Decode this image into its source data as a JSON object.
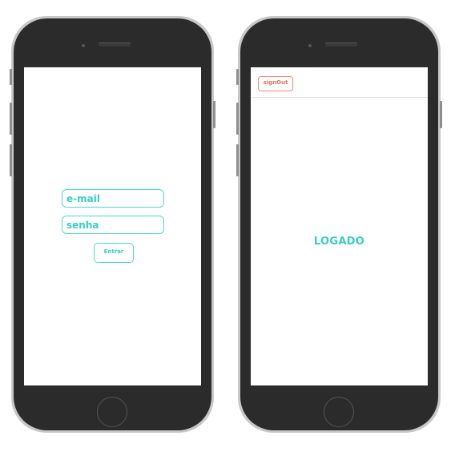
{
  "login_screen": {
    "email_placeholder": "e-mail",
    "password_placeholder": "senha",
    "submit_label": "Entrar"
  },
  "home_screen": {
    "signout_label": "signOut",
    "status_text": "LOGADO"
  },
  "colors": {
    "accent": "#38cfbf",
    "signout": "#e9705e",
    "phone_body": "#2b2b2b",
    "phone_frame": "#c8c8c8"
  }
}
